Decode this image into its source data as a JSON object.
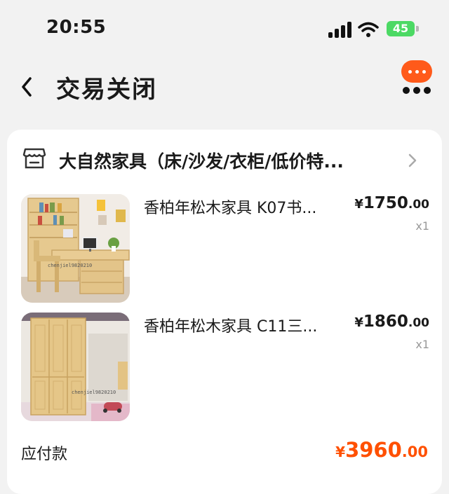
{
  "status_bar": {
    "time": "20:55",
    "battery": "45"
  },
  "nav": {
    "title": "交易关闭",
    "accent_color": "#ff5a1a"
  },
  "order": {
    "shop_name": "大自然家具（床/沙发/衣柜/低价特...",
    "items": [
      {
        "title": "香柏年松木家具 K07书...",
        "currency": "¥",
        "price_int": "1750",
        "price_dec": ".00",
        "qty": "x1",
        "image": "desk-bookshelf-photo",
        "watermark": "chenjiel9820210"
      },
      {
        "title": "香柏年松木家具  C11三...",
        "currency": "¥",
        "price_int": "1860",
        "price_dec": ".00",
        "qty": "x1",
        "image": "wardrobe-photo",
        "watermark": "chenjiel9820210"
      }
    ],
    "total_label": "应付款",
    "total_currency": "¥",
    "total_int": "3960",
    "total_dec": ".00",
    "total_color": "#ff5000"
  }
}
